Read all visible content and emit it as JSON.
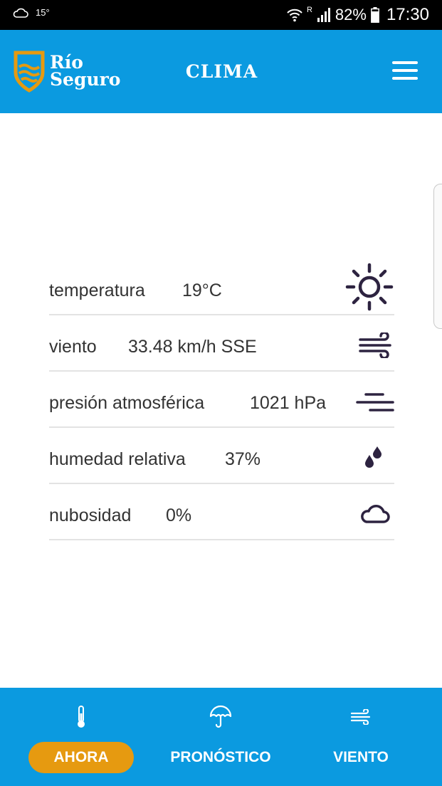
{
  "status_bar": {
    "weather_temp": "15°",
    "roaming": "R",
    "battery": "82%",
    "time": "17:30"
  },
  "header": {
    "logo_line1": "Río",
    "logo_line2": "Seguro",
    "title": "CLIMA"
  },
  "weather": [
    {
      "label": "temperatura",
      "value": "19°C",
      "icon": "sun-icon"
    },
    {
      "label": "viento",
      "value": "33.48 km/h SSE",
      "icon": "wind-icon"
    },
    {
      "label": "presión atmosférica",
      "value": "1021 hPa",
      "icon": "pressure-lines-icon"
    },
    {
      "label": "humedad relativa",
      "value": "37%",
      "icon": "drops-icon"
    },
    {
      "label": "nubosidad",
      "value": "0%",
      "icon": "cloud-icon"
    }
  ],
  "nav": [
    {
      "label": "AHORA",
      "icon": "thermometer-icon",
      "active": true
    },
    {
      "label": "PRONÓSTICO",
      "icon": "umbrella-icon",
      "active": false
    },
    {
      "label": "VIENTO",
      "icon": "wind-icon",
      "active": false
    }
  ],
  "colors": {
    "primary": "#0b9ae0",
    "accent": "#e69a10",
    "icon_dark": "#2d2340",
    "status_bar": "#000000"
  }
}
